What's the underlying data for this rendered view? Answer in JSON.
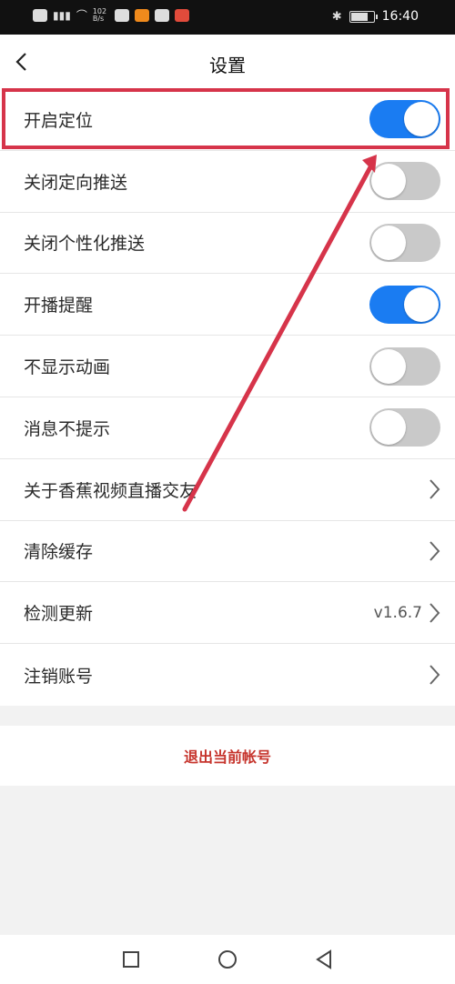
{
  "status_bar": {
    "time": "16:40",
    "net_speed": "102\nB/s",
    "icons": [
      "message-icon",
      "signal-icon",
      "wifi-icon",
      "app-icon-1",
      "app-icon-2",
      "app-icon-3",
      "app-icon-4",
      "bluetooth-icon",
      "battery-icon"
    ]
  },
  "header": {
    "title": "设置",
    "back_icon": "chevron-left-icon"
  },
  "settings": [
    {
      "label": "开启定位",
      "toggle": true
    },
    {
      "label": "关闭定向推送",
      "toggle": false
    },
    {
      "label": "关闭个性化推送",
      "toggle": false
    },
    {
      "label": "开播提醒",
      "toggle": true
    },
    {
      "label": "不显示动画",
      "toggle": false
    },
    {
      "label": "消息不提示",
      "toggle": false
    },
    {
      "label": "关于香蕉视频直播交友",
      "chevron": true
    },
    {
      "label": "清除缓存",
      "chevron": true
    },
    {
      "label": "检测更新",
      "value": "v1.6.7",
      "chevron": true
    },
    {
      "label": "注销账号",
      "chevron": true
    }
  ],
  "logout": {
    "label": "退出当前帐号"
  },
  "colors": {
    "toggle_on": "#1a7cf2",
    "toggle_off": "#c9c9c9",
    "logout_text": "#c6342c",
    "annotation": "#d6344a"
  },
  "nav": [
    "recent-apps-icon",
    "home-icon",
    "back-icon"
  ]
}
